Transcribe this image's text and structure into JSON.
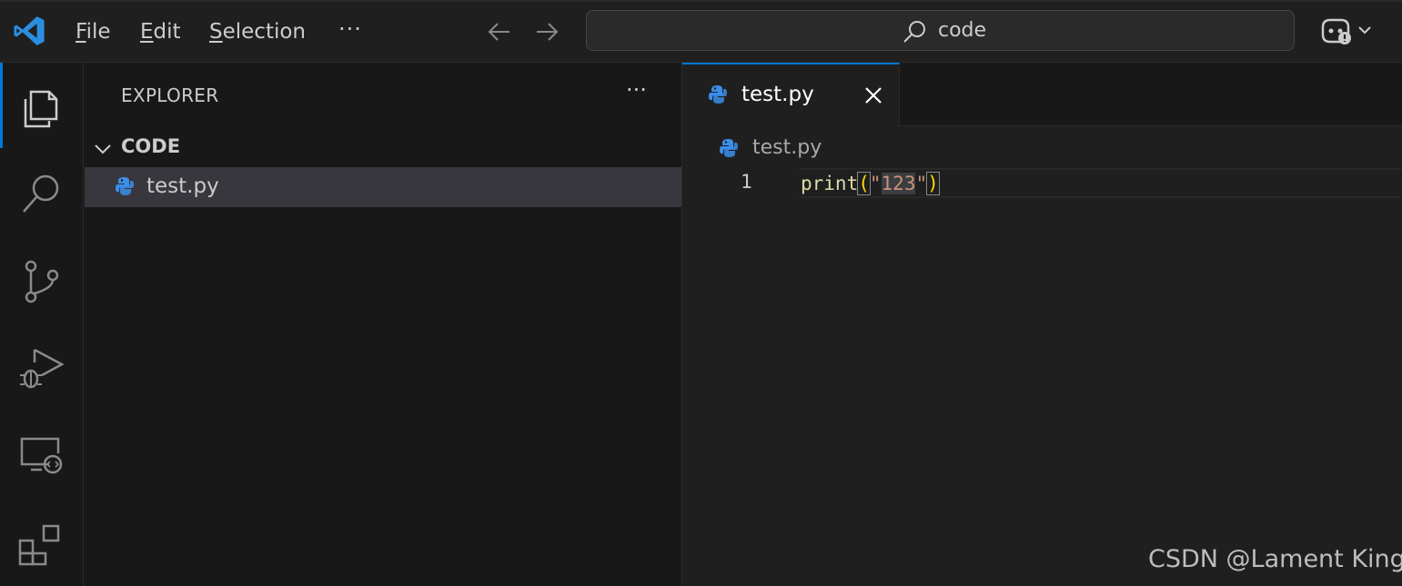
{
  "menu": {
    "file": {
      "accel": "F",
      "rest": "ile"
    },
    "edit": {
      "accel": "E",
      "rest": "dit"
    },
    "selection": {
      "accel": "S",
      "rest": "election"
    },
    "more": "···"
  },
  "command_center": {
    "text": "code"
  },
  "sidebar": {
    "title": "EXPLORER",
    "more": "···",
    "folder": "CODE",
    "files": [
      {
        "name": "test.py"
      }
    ]
  },
  "editor": {
    "tab": {
      "label": "test.py"
    },
    "breadcrumb": "test.py",
    "lines": [
      {
        "number": "1",
        "fn": "print",
        "open": "(",
        "q1": "\"",
        "str": "123",
        "q2": "\"",
        "close": ")"
      }
    ]
  },
  "watermark": "CSDN @Lament King",
  "icons": {
    "app": "vscode-logo-icon",
    "back": "arrow-left-icon",
    "forward": "arrow-right-icon",
    "search": "search-icon",
    "copilot": "copilot-icon",
    "activity": [
      "explorer-icon",
      "search-icon",
      "source-control-icon",
      "run-debug-icon",
      "remote-explorer-icon",
      "extensions-icon"
    ],
    "file": "python-icon",
    "close": "close-icon"
  },
  "colors": {
    "accent": "#0078d4",
    "python_blue": "#3b8eea",
    "string": "#ce9178",
    "function": "#dcdcaa"
  }
}
